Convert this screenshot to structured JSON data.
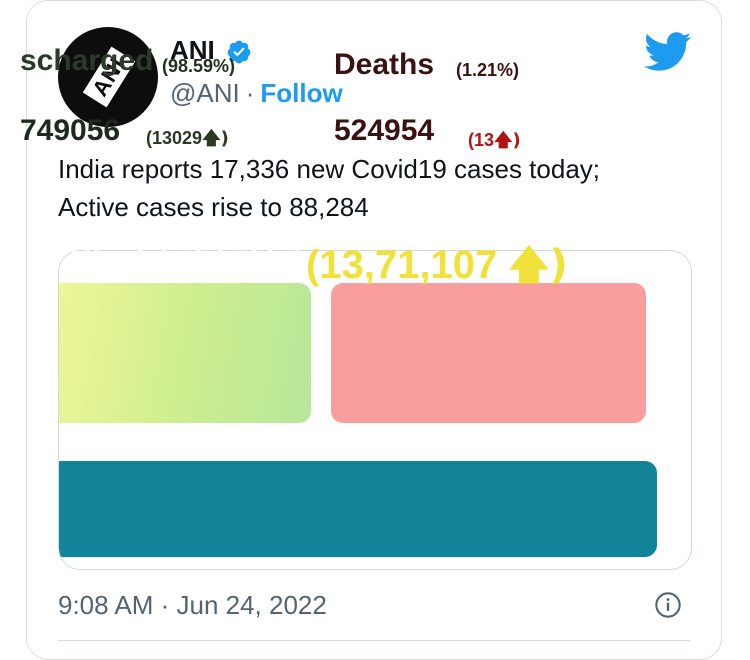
{
  "author": {
    "name": "ANI",
    "handle": "@ANI",
    "separator": "·",
    "follow_label": "Follow",
    "avatar_text": "ANI"
  },
  "tweet": {
    "line1": "India reports 17,336 new Covid19 cases today;",
    "line2": "Active cases rise to 88,284"
  },
  "media": {
    "discharged": {
      "title": "scharged",
      "percent": "(98.59%)",
      "count": "749056",
      "change": "(13029",
      "arrow": "🡅)"
    },
    "deaths": {
      "title": "Deaths",
      "percent": "(1.21%)",
      "count": "524954",
      "change": "(13",
      "arrow": "🡅)"
    },
    "vaccination": {
      "total": ": 1,96,77,33,217",
      "change": "(13,71,107 ",
      "arrow": "🡅)"
    }
  },
  "footer": {
    "timestamp": "9:08 AM · Jun 24, 2022"
  },
  "colors": {
    "twitter_blue": "#1d9bf0",
    "green_panel": "#cdee8f",
    "red_panel": "#f89e9f",
    "blue_panel": "#12849a",
    "yellow_text": "#f0e23a"
  }
}
